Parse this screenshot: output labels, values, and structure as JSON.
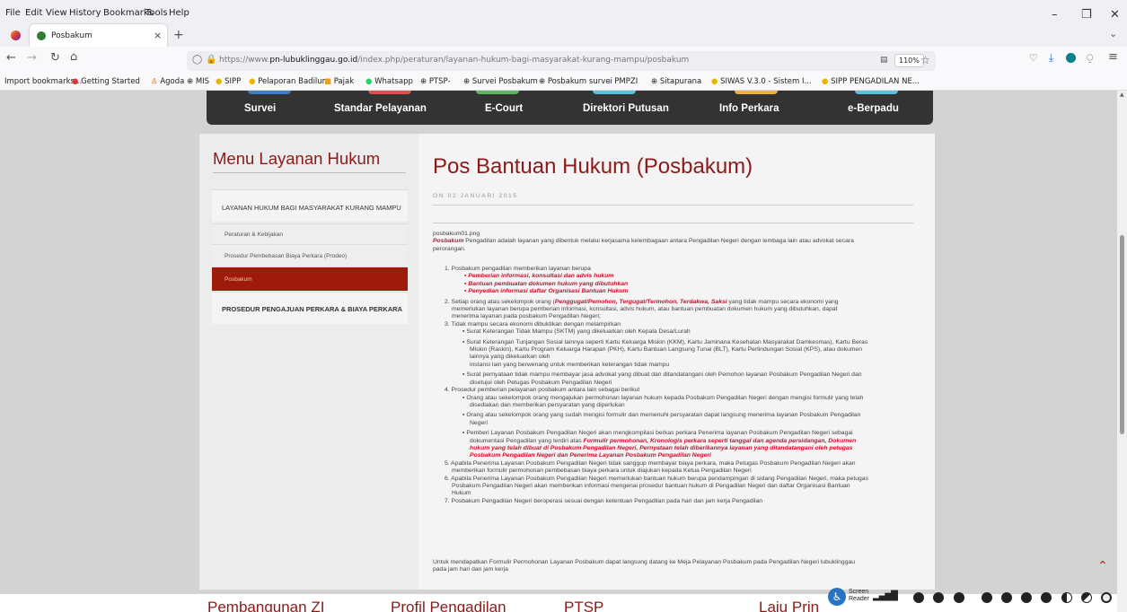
{
  "menubar": {
    "items": [
      "File",
      "Edit",
      "View",
      "History",
      "Bookmarks",
      "Tools",
      "Help"
    ]
  },
  "tab": {
    "title": "Posbakum"
  },
  "url": {
    "prefix": "https://www.",
    "domain": "pn-lubuklinggau.go.id",
    "path": "/index.php/peraturan/layanan-hukum-bagi-masyarakat-kurang-mampu/posbakum",
    "zoom": "110%"
  },
  "bookmarks": [
    "Import bookmarks...",
    "Getting Started",
    "Agoda",
    "MIS",
    "SIPP",
    "Pelaporan Badilum",
    "Pajak",
    "Whatsapp",
    "PTSP-",
    "Survei Posbakum",
    "Posbakum survei",
    "PMPZI",
    "Sitapurana",
    "SIWAS V.3.0 - Sistem I...",
    "SIPP PENGADILAN NE..."
  ],
  "nav": [
    "Survei",
    "Standar Pelayanan",
    "E-Court",
    "Direktori Putusan",
    "Info Perkara",
    "e-Berpadu"
  ],
  "sidebar": {
    "heading": "Menu Layanan Hukum",
    "section1": "LAYANAN HUKUM BAGI MASYARAKAT KURANG MAMPU",
    "items": [
      "Peraturan & Kebijakan",
      "Prosedur Pembebasan Biaya Perkara (Prodeo)",
      "Posbakum"
    ],
    "section2": "PROSEDUR PENGAJUAN PERKARA & BIAYA PERKARA"
  },
  "article": {
    "title": "Pos Bantuan Hukum (Posbakum)",
    "date": "ON 02 JANUARI 2015",
    "img": "posbakum01.png",
    "intro_bold": "Posbakum",
    "intro": " Pengadilan adalah layanan yang dibentuk melalui kerjasama kelembagaan antara Pengadilan Negeri dengan lembaga lain atau advokat secara",
    "intro2": "perorangan.",
    "p1": "1. Posbakum pengadilan memberikan layanan berupa",
    "b1": "Pemberian informasi, konsultasi dan advis hukum",
    "b2": "Bantuan pembuatan dokumen hukum yang dibutuhkan",
    "b3": "Penyedian informasi daftar Organisasi Bantuan Hukum",
    "p2a": "2. Setiap orang atau sekelompok orang (",
    "p2b": "Penggugat/Pemohon, Tergugat/Termohon, Terdakwa, Saksi",
    "p2c": " yang tidak mampu secara ekonomi yang",
    "p2d": "memerlukan layanan berupa pemberian informasi, konsultasi, advis hukum, atau bantuan pembuatan dokumen hukum yang dibutuhkan, dapat",
    "p2e": "menerima layanan pada posbakum Pengadilan Negeri;",
    "p3": "3. Tidak mampu secara ekonomi dibuktikan dengan melampirkan",
    "p3a": "Surat Keterangan Tidak Mampu (SKTM) yang dikeluarkan oleh Kepala Desa/Lurah",
    "p3b1": "Surat Keterangan Tunjangan Sosial lainnya seperti Kartu Keluarga Miskin (KKM), Kartu Jaminana Kesehatan Masyarakat Damkesmas), Kartu Beras",
    "p3b2": "Miskin (Raskin), Kartu Program Keluarga Harapan (PKH), Kartu Bantuan Langsung Tunai (BLT), Kartu Perlindungan Sosial (KPS), atau dokumen",
    "p3b3": "lainnya yang dikeluarkan oleh",
    "p3b4": "instansi lain yang berwenang untuk memberikan keterangan tidak mampu",
    "p3c1": "Surat pernyataan tidak mampu membayar jasa advokat yang dibuat dan ditandatangani oleh Pemohon layanan Posbakum Pengadilan Negeri dan",
    "p3c2": "disetujui oleh Petugas Posbakum Pengadilan Negeri",
    "p4": "4. Prosedur pemberian pelayanan posbakum antara lain sebagai berikut",
    "p4a1": "Orang atau sekelompok orang mengajukan permohonan layanan hukum kepada Posbakum Pengadilan Negeri dengan mengisi formulir yang telah",
    "p4a2": "disediakan dan memberikan persyaratan yang diperlukan",
    "p4b1": "Orang atau sekelompok orang yang sudah mengisi formulir dan memenuhi persyaratan dapat langsung menerima layanan Posbakum Pengadilan",
    "p4b2": "Negeri",
    "p4c1": "Pemberi Layanan Posbakum Pengadilan Negeri akan mengkompilasi berkas perkara Penerima layanan Posbakum Pengadilan Negeri sebagai",
    "p4c2a": "dokumentasi Pengadilan yang terdiri atas ",
    "p4c2b": "Formulir permohonan, Kronologis perkara seperti tanggal dan agenda persidangan, Dokumen",
    "p4c3": "hukum yang telah dibuat di Posbakum Pengadilan Negeri, Pernyataan telah diberikannya layanan yang ditandatangani oleh petugas",
    "p4c4": "Posbakum Pengadilan Negeri dan Penerima Layanan Posbakum Pengadilan Negeri",
    "p5a": "5. Apabila Penerima Layanan Posbakum Pengadilan Negeri tidak sanggup membayar biaya perkara, maka Petugas Posbakum Pengadilan Negeri akan",
    "p5b": "memberikan formulir permohonan pembebasan biaya perkara untuk diajukan kepada Ketua Pengadilan Negeri",
    "p6a": "6. Apabila Penerima Layanan Posbakum Pengadilan Negeri memerlukan bantuan hukum berupa pendampingan di sidang Pengadilan Negeri, maka petugas",
    "p6b": "Posbakum Pengadilan Negeri akan memberikan informasi mengenai prosedur bantuan hukum di Pengadilan Negeri dan daftar Organisasi Bantuan",
    "p6c": "Hukum",
    "p7": "7. Posbakum Pengadilan Negeri beroperasi sesuai dengan ketentuan Pengadilan pada hari dan jam kerja Pengadilan",
    "closing1": "Untuk mendapatkan Formulir Permohonan Layanan Posbakum dapat langsung datang ke Meja Pelayanan Posbakum pada Pengadilan Negeri lubuklinggau",
    "closing2": "pada jam hari dan jam kerja"
  },
  "footer": [
    "Pembangunan ZI",
    "Profil Pengadilan",
    "PTSP",
    "Laju Prin"
  ],
  "screenreader": {
    "line1": "Screen",
    "line2": "Reader"
  }
}
